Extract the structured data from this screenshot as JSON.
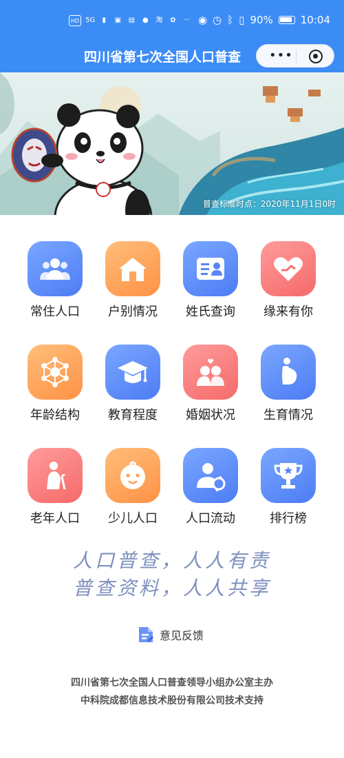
{
  "status_bar": {
    "left_icons": [
      "HD",
      "5G",
      "signal-icon",
      "app-icon",
      "app-icon",
      "chat-icon",
      "淘",
      "paw-icon",
      "···"
    ],
    "right_icons": [
      "eye-icon",
      "alarm-icon",
      "bluetooth-icon",
      "vibrate-icon"
    ],
    "battery": "90%",
    "time": "10:04"
  },
  "mini_program": {
    "title": "四川省第七次全国人口普查",
    "more_label": "•••"
  },
  "banner": {
    "census_time": "普查标准时点：2020年11月1日0时"
  },
  "grid": [
    {
      "label": "常住人口",
      "icon": "people-group-icon",
      "color": "#5b85f7"
    },
    {
      "label": "户别情况",
      "icon": "house-icon",
      "color": "#ff9c52"
    },
    {
      "label": "姓氏查询",
      "icon": "id-card-icon",
      "color": "#5b85f7"
    },
    {
      "label": "缘来有你",
      "icon": "heart-hands-icon",
      "color": "#f57272"
    },
    {
      "label": "年龄结构",
      "icon": "structure-icon",
      "color": "#ff9c52"
    },
    {
      "label": "教育程度",
      "icon": "graduation-cap-icon",
      "color": "#5b85f7"
    },
    {
      "label": "婚姻状况",
      "icon": "couple-icon",
      "color": "#f57272"
    },
    {
      "label": "生育情况",
      "icon": "pregnant-icon",
      "color": "#5b85f7"
    },
    {
      "label": "老年人口",
      "icon": "elderly-icon",
      "color": "#f57272"
    },
    {
      "label": "少儿人口",
      "icon": "baby-face-icon",
      "color": "#ff9c52"
    },
    {
      "label": "人口流动",
      "icon": "person-flow-icon",
      "color": "#5b85f7"
    },
    {
      "label": "排行榜",
      "icon": "trophy-icon",
      "color": "#5b85f7"
    }
  ],
  "slogan": {
    "line1": "人口普查，人人有责",
    "line2": "普查资料，人人共享"
  },
  "feedback": {
    "label": "意见反馈"
  },
  "footer": {
    "line1": "四川省第七次全国人口普查领导小组办公室主办",
    "line2": "中科院成都信息技术股份有限公司技术支持"
  }
}
